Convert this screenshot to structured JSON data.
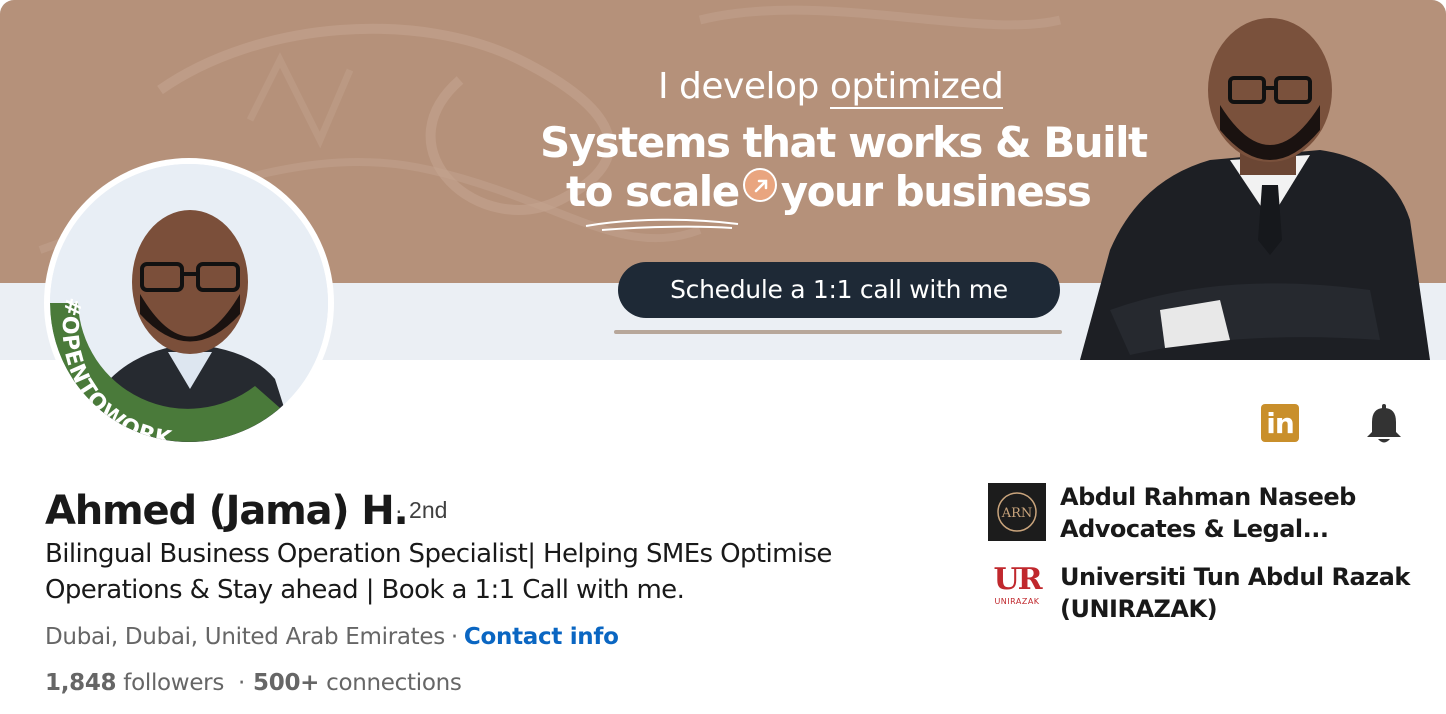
{
  "banner": {
    "line1_prefix": "I develop ",
    "line1_emph": "optimized",
    "line2": "Systems that works & Built",
    "line3_a": "to scale",
    "line3_b": "your business",
    "cta": "Schedule a 1:1 call with me"
  },
  "avatar": {
    "ring_text": "#OPENTOWORK"
  },
  "profile": {
    "name": "Ahmed (Jama) H.",
    "degree": "· 2nd",
    "headline": "Bilingual Business Operation Specialist| Helping SMEs Optimise Operations & Stay ahead | Book a 1:1 Call with me.",
    "location": "Dubai, Dubai, United Arab Emirates",
    "location_sep": "·",
    "contact_info": "Contact info",
    "followers_count": "1,848",
    "followers_label": "followers",
    "stats_sep": "·",
    "connections_count": "500+",
    "connections_label": "connections"
  },
  "actions": {
    "linkedin_icon_text": "in",
    "linkedin_icon": "linkedin-icon",
    "bell_icon": "bell-icon"
  },
  "orgs": [
    {
      "name": "Abdul Rahman Naseeb Advocates & Legal...",
      "logo_text": "ARN"
    },
    {
      "name": "Universiti Tun Abdul Razak (UNIRAZAK)",
      "logo_text": "UR",
      "logo_sub": "UNIRAZAK"
    }
  ],
  "colors": {
    "banner_brown": "#b5917a",
    "cta_bg": "#1e2936",
    "link": "#0a66c2",
    "open_to_work_green": "#4a7a3a",
    "linkedin_gold": "#c98f2b",
    "unirazak_red": "#c0282d"
  }
}
